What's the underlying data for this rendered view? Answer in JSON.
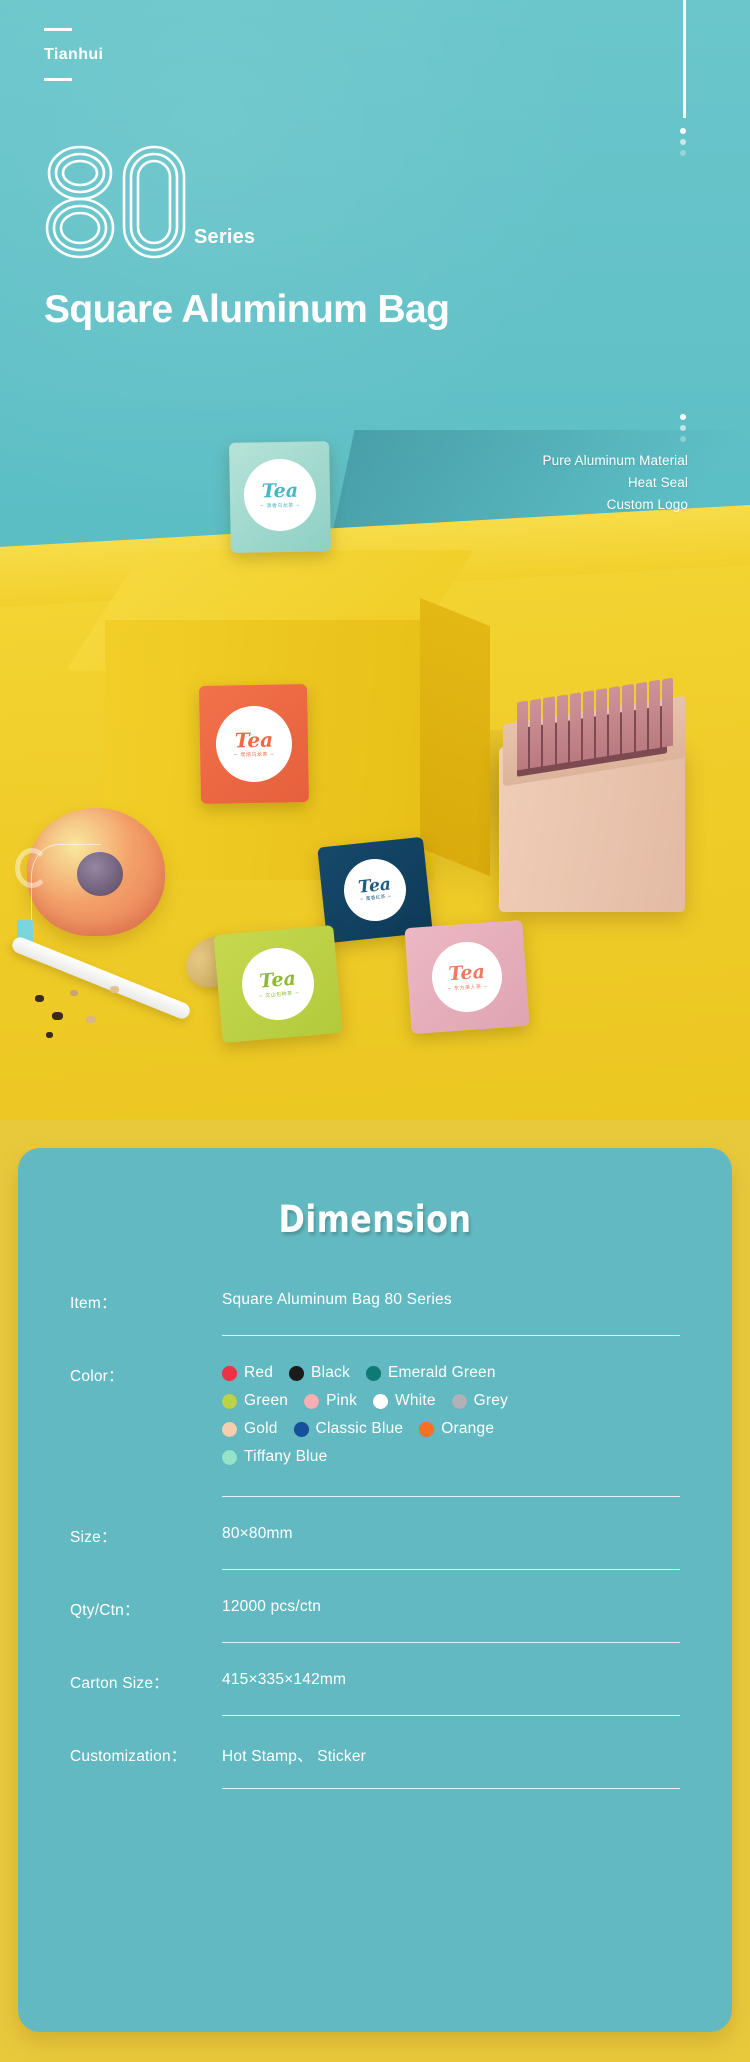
{
  "hero": {
    "brand": "Tianhui",
    "series_number": "80",
    "series_label": "Series",
    "headline": "Square Aluminum Bag",
    "features": [
      "Pure Aluminum Material",
      "Heat Seal",
      "Custom Logo"
    ]
  },
  "photo": {
    "packets": [
      {
        "name": "mint-packet",
        "tea_label": "Tea",
        "sub_label": "~ 清香乌龙茶 ~",
        "color": "#9ed5c9"
      },
      {
        "name": "orange-packet",
        "tea_label": "Tea",
        "sub_label": "~ 炭焙乌龙茶 ~",
        "color": "#ec6a44"
      },
      {
        "name": "navy-packet",
        "tea_label": "Tea",
        "sub_label": "~ 蜜香红茶 ~",
        "color": "#12405f"
      },
      {
        "name": "green-packet",
        "tea_label": "Tea",
        "sub_label": "~ 文山包种茶 ~",
        "color": "#bdd246"
      },
      {
        "name": "pink-packet",
        "tea_label": "Tea",
        "sub_label": "~ 东方美人茶 ~",
        "color": "#e6aeba"
      }
    ]
  },
  "card": {
    "title": "Dimension",
    "rows": [
      {
        "key": "Item：",
        "value": "Square Aluminum Bag 80 Series"
      },
      {
        "key": "Size：",
        "value": "80×80mm"
      },
      {
        "key": "Qty/Ctn：",
        "value": "12000 pcs/ctn"
      },
      {
        "key": "Carton Size：",
        "value": "415×335×142mm"
      },
      {
        "key": "Customization：",
        "value": "Hot Stamp、 Sticker"
      }
    ],
    "color_row_key": "Color：",
    "colors": [
      {
        "label": "Red",
        "hex": "#ec3244"
      },
      {
        "label": "Black",
        "hex": "#1b1b1b"
      },
      {
        "label": "Emerald Green",
        "hex": "#0d7b74"
      },
      {
        "label": "Green",
        "hex": "#bcd24a"
      },
      {
        "label": "Pink",
        "hex": "#f5afb5"
      },
      {
        "label": "White",
        "hex": "#ffffff"
      },
      {
        "label": "Grey",
        "hex": "#b1b1b8"
      },
      {
        "label": "Gold",
        "hex": "#f6cdae"
      },
      {
        "label": "Classic Blue",
        "hex": "#14509b"
      },
      {
        "label": "Orange",
        "hex": "#f97024"
      },
      {
        "label": "Tiffany Blue",
        "hex": "#93e4c9"
      }
    ]
  },
  "theme": {
    "hero_teal": "#63c3c9",
    "card_teal": "#63b9c1",
    "page_yellow": "#e9c93c",
    "photo_yellow": "#f1ce28"
  }
}
